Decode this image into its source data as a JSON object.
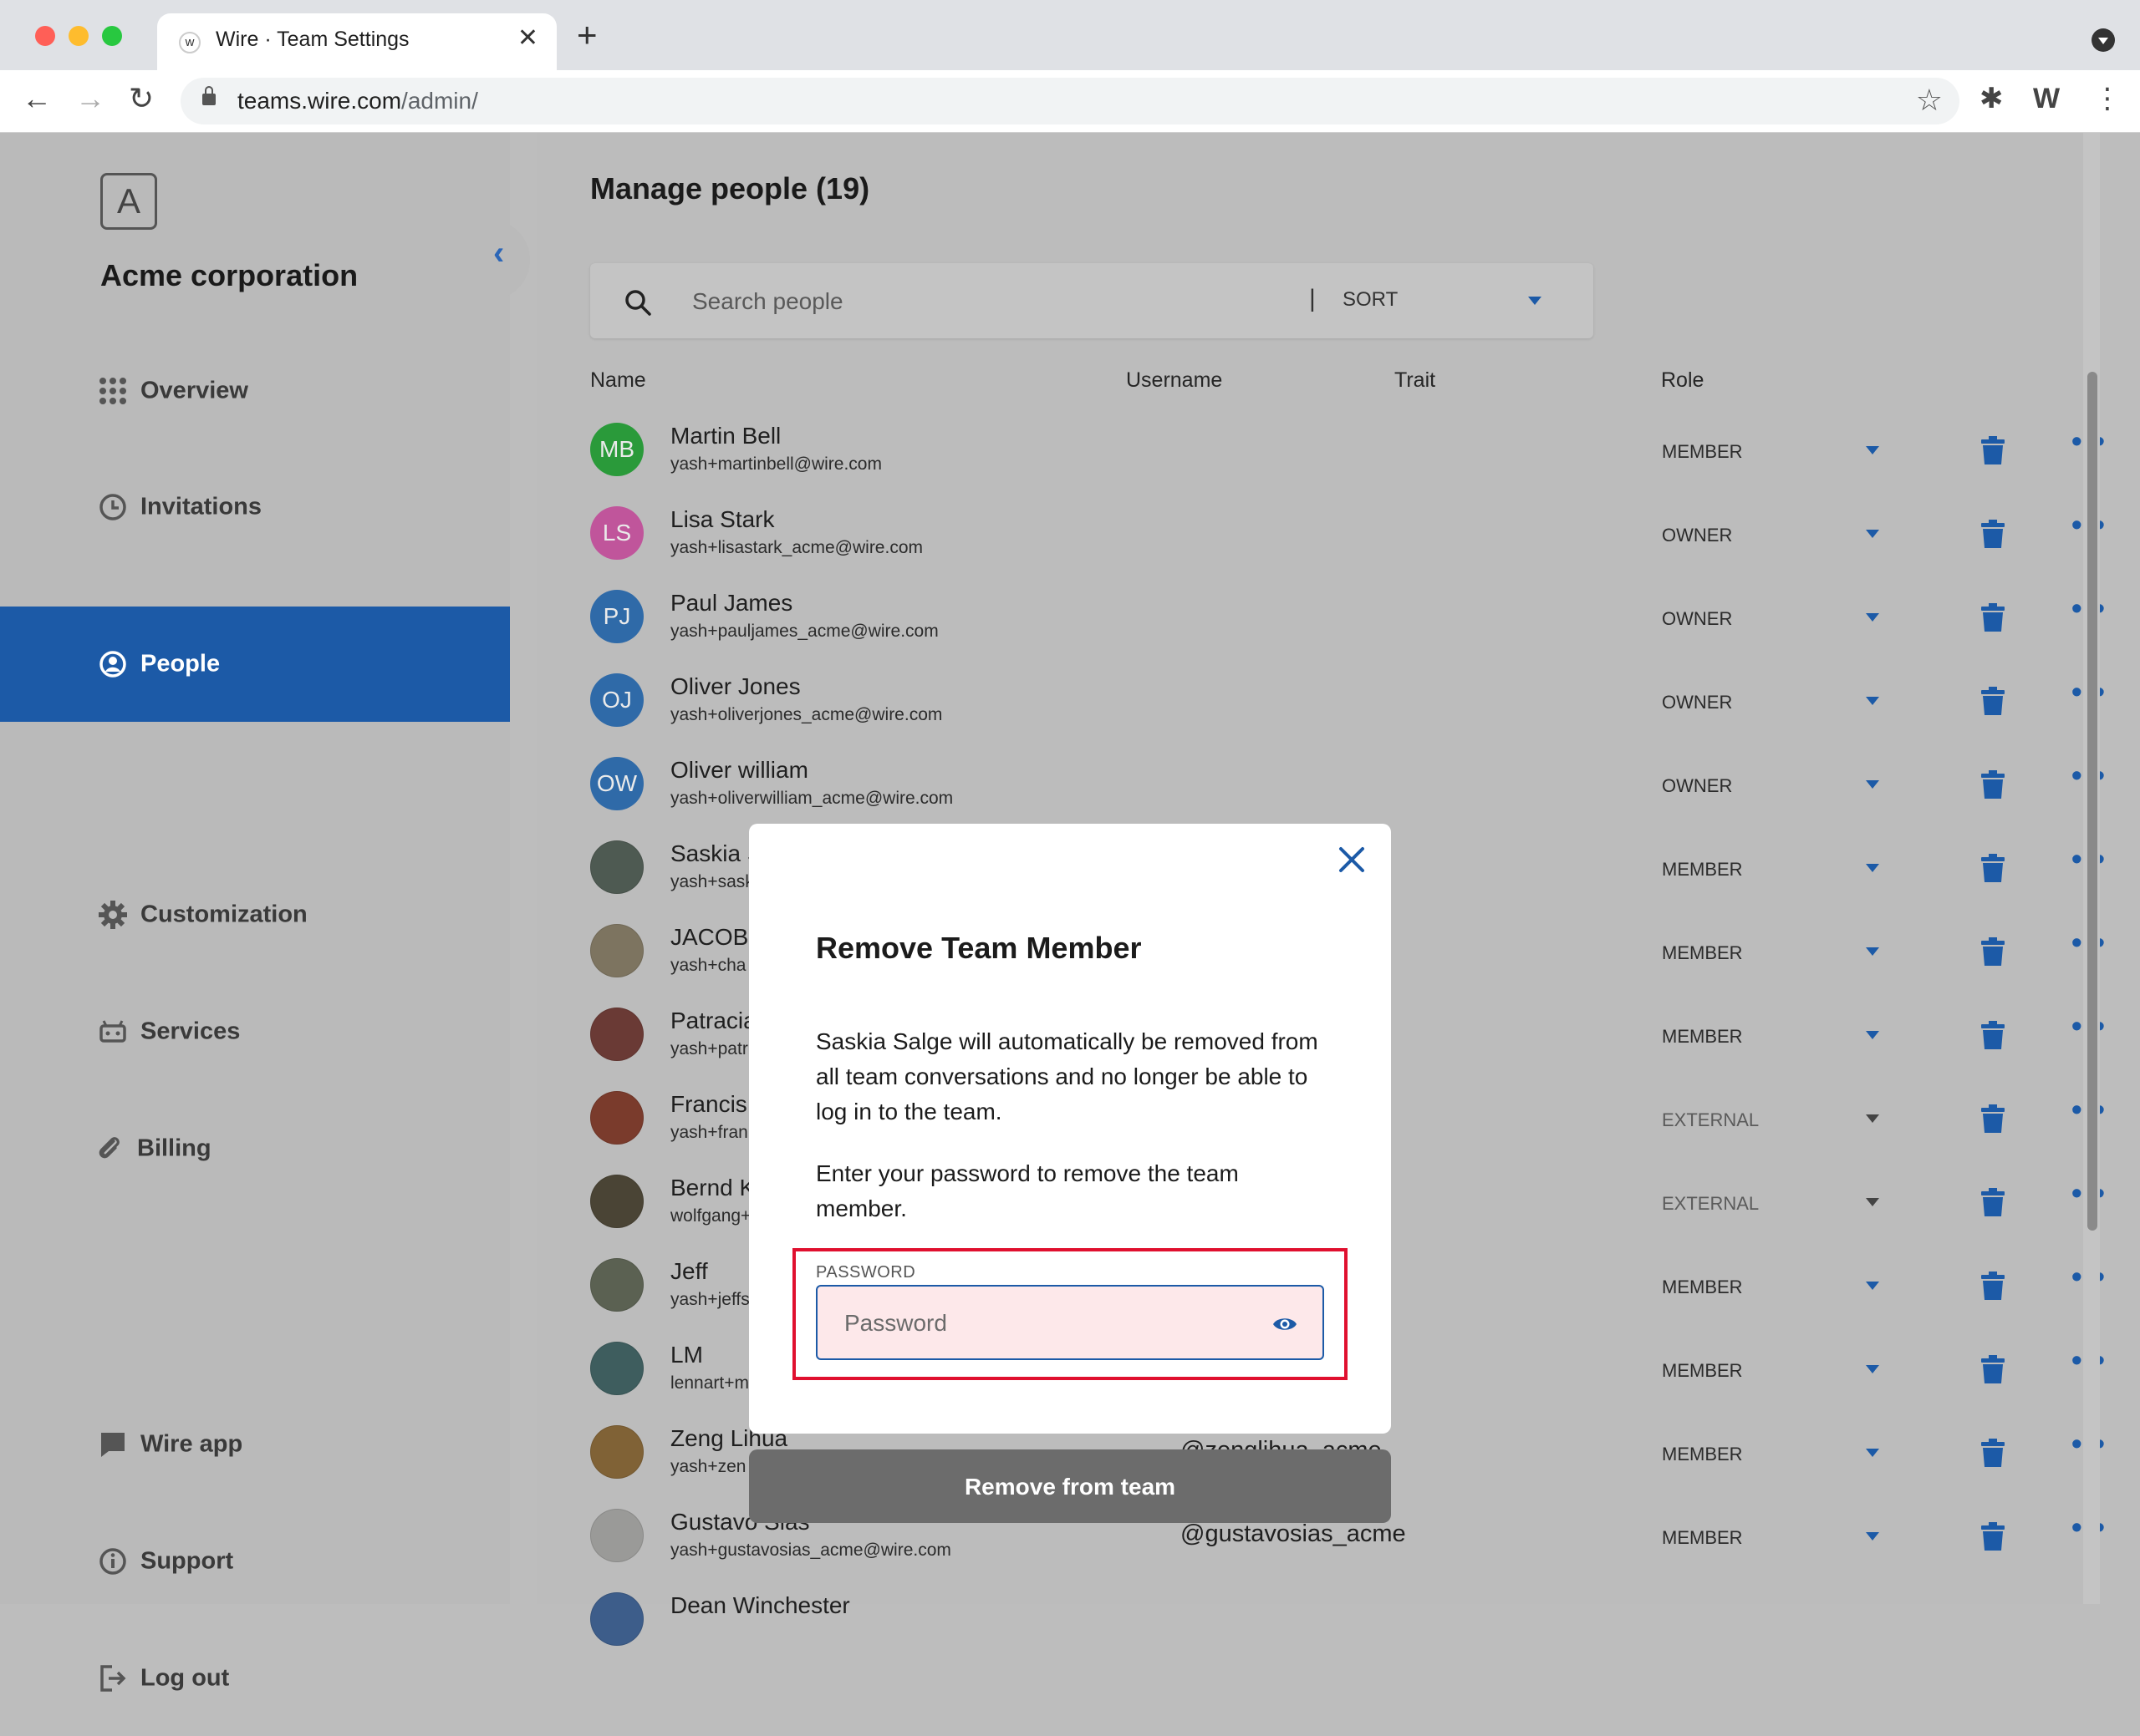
{
  "browser": {
    "tab_title": "Wire · Team Settings",
    "favicon_glyph": "w",
    "url_host": "teams.wire.com",
    "url_path": "/admin/"
  },
  "sidebar": {
    "logo_letter": "A",
    "org_name": "Acme corporation",
    "items": [
      {
        "label": "Overview",
        "icon": "grid-icon"
      },
      {
        "label": "Invitations",
        "icon": "clock-icon"
      },
      {
        "label": "People",
        "icon": "person-circle-icon",
        "active": true
      },
      {
        "label": "Customization",
        "icon": "gear-icon"
      },
      {
        "label": "Services",
        "icon": "robot-icon"
      },
      {
        "label": "Billing",
        "icon": "paperclip-icon"
      }
    ],
    "footer_items": [
      {
        "label": "Wire app",
        "icon": "chat-bubble-icon"
      },
      {
        "label": "Support",
        "icon": "info-icon"
      },
      {
        "label": "Log out",
        "icon": "logout-icon"
      }
    ]
  },
  "main": {
    "title": "Manage people (19)",
    "search_placeholder": "Search people",
    "sort_separator": "|",
    "sort_label": "SORT",
    "columns": {
      "name": "Name",
      "username": "Username",
      "trait": "Trait",
      "role": "Role"
    },
    "rows": [
      {
        "initials": "MB",
        "name": "Martin Bell",
        "email": "yash+martinbell@wire.com",
        "username": "",
        "role": "MEMBER",
        "avatar_color": "#2a9a3a"
      },
      {
        "initials": "LS",
        "name": "Lisa Stark",
        "email": "yash+lisastark_acme@wire.com",
        "username": "",
        "role": "OWNER",
        "avatar_color": "#c0559b"
      },
      {
        "initials": "PJ",
        "name": "Paul James",
        "email": "yash+pauljames_acme@wire.com",
        "username": "",
        "role": "OWNER",
        "avatar_color": "#2f6aa8"
      },
      {
        "initials": "OJ",
        "name": "Oliver Jones",
        "email": "yash+oliverjones_acme@wire.com",
        "username": "",
        "role": "OWNER",
        "avatar_color": "#2f6aa8"
      },
      {
        "initials": "OW",
        "name": "Oliver william",
        "email": "yash+oliverwilliam_acme@wire.com",
        "username": "",
        "role": "OWNER",
        "avatar_color": "#2f6aa8"
      },
      {
        "initials": "",
        "name": "Saskia S",
        "email": "yash+sask",
        "username": "",
        "role": "MEMBER",
        "avatar_color": "#4e5a52"
      },
      {
        "initials": "",
        "name": "JACOB",
        "email": "yash+cha",
        "username": "",
        "role": "MEMBER",
        "avatar_color": "#7d7460"
      },
      {
        "initials": "",
        "name": "Patracia",
        "email": "yash+patr",
        "username": "",
        "role": "MEMBER",
        "avatar_color": "#6a3a35"
      },
      {
        "initials": "",
        "name": "Francis",
        "email": "yash+fran",
        "username": "",
        "role": "EXTERNAL",
        "avatar_color": "#7a3b2c"
      },
      {
        "initials": "",
        "name": "Bernd K",
        "email": "wolfgang+",
        "username": "",
        "role": "EXTERNAL",
        "avatar_color": "#4a4435"
      },
      {
        "initials": "",
        "name": "Jeff",
        "email": "yash+jeffs",
        "username": "",
        "role": "MEMBER",
        "avatar_color": "#5b6152"
      },
      {
        "initials": "",
        "name": "LM",
        "email": "lennart+m",
        "username": "",
        "role": "MEMBER",
        "avatar_color": "#3e5d5e"
      },
      {
        "initials": "",
        "name": "Zeng Lihua",
        "email": "yash+zen",
        "username": "@zenglihua_acme",
        "role": "MEMBER",
        "avatar_color": "#806236"
      },
      {
        "initials": "",
        "name": "Gustavo Sias",
        "email": "yash+gustavosias_acme@wire.com",
        "username": "@gustavosias_acme",
        "role": "MEMBER",
        "avatar_color": "#9a9a98"
      },
      {
        "initials": "",
        "name": "Dean Winchester",
        "email": "",
        "username": "",
        "role": "",
        "avatar_color": "#3d5d8a"
      }
    ]
  },
  "modal": {
    "title": "Remove Team Member",
    "body": "Saskia Salge will automatically be removed from all team conversations and no longer be able to log in to the team.",
    "instruction": "Enter your password to remove the team member.",
    "password_label": "PASSWORD",
    "password_placeholder": "Password",
    "submit_label": "Remove from team"
  },
  "colors": {
    "accent": "#1c5aa7",
    "highlight_border": "#e0102f",
    "overlay": "#bcbcbc"
  }
}
